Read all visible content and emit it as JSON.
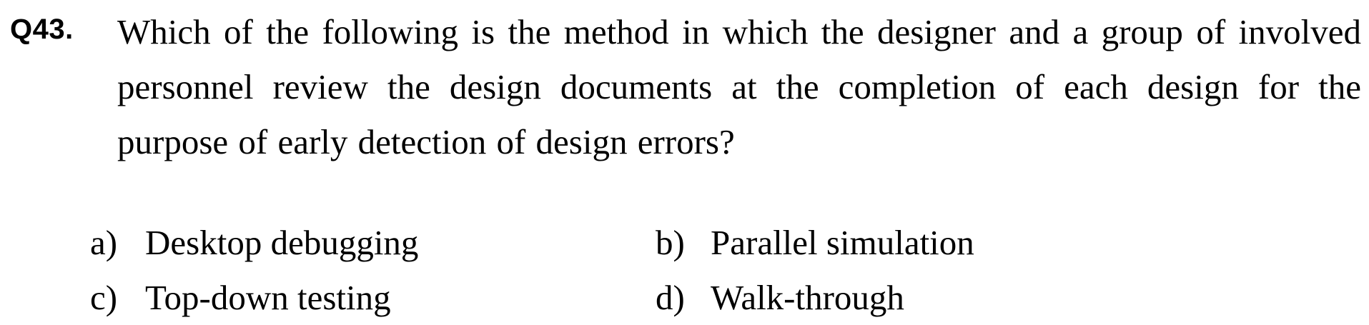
{
  "question": {
    "number": "Q43.",
    "text": "Which of the following is the method in which the designer and a group of involved personnel review the design documents at the completion of each design for the purpose of early detection of design errors?"
  },
  "options": [
    {
      "letter": "a)",
      "text": "Desktop debugging"
    },
    {
      "letter": "b)",
      "text": "Parallel simulation"
    },
    {
      "letter": "c)",
      "text": "Top-down testing"
    },
    {
      "letter": "d)",
      "text": "Walk-through"
    }
  ]
}
